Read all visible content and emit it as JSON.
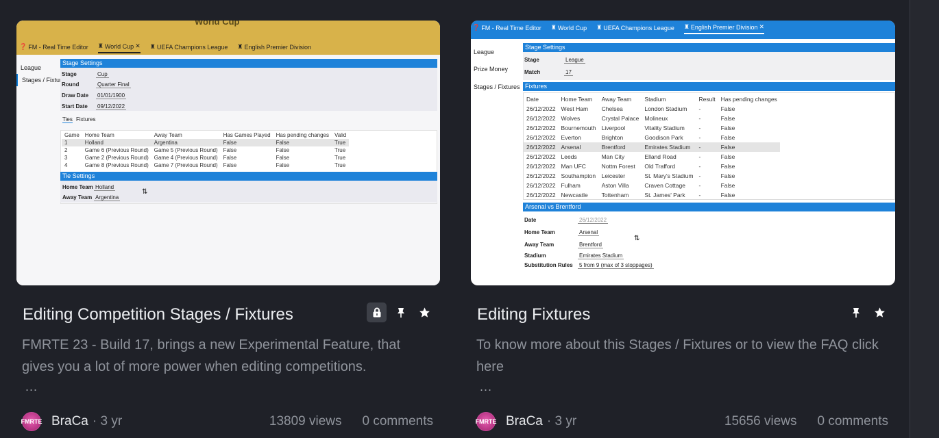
{
  "cards": [
    {
      "title": "Editing Competition Stages / Fixtures",
      "locked": true,
      "excerpt": "FMRTE 23 - Build 17, brings a new Experimental Feature, that gives you a lot of more power when editing competitions.",
      "ellipsis": "...",
      "author": "BraCa",
      "age": "3 yr",
      "views": "13809 views",
      "comments": "0 comments",
      "avatar_text": "FMRTE",
      "thumbnail": {
        "banner_text": "World Cup",
        "tabs": [
          "FM - Real Time Editor",
          "World Cup",
          "UEFA Champions League",
          "English Premier Division"
        ],
        "active_tab_index": 1,
        "sidebar": [
          "League",
          "Stages / Fixtures"
        ],
        "section_stage": "Stage Settings",
        "fields": [
          {
            "label": "Stage",
            "value": "Cup"
          },
          {
            "label": "Round",
            "value": "Quarter Final"
          },
          {
            "label": "Draw Date",
            "value": "01/01/1900"
          },
          {
            "label": "Start Date",
            "value": "09/12/2022"
          }
        ],
        "subtabs": [
          "Ties",
          "Fixtures"
        ],
        "table_headers": [
          "Game",
          "Home Team",
          "Away Team",
          "Has Games Played",
          "Has pending changes",
          "Valid"
        ],
        "rows": [
          [
            "1",
            "Holland",
            "Argentina",
            "False",
            "False",
            "True"
          ],
          [
            "2",
            "Game 6 (Previous Round)",
            "Game 5 (Previous Round)",
            "False",
            "False",
            "True"
          ],
          [
            "3",
            "Game 2 (Previous Round)",
            "Game 4 (Previous Round)",
            "False",
            "False",
            "True"
          ],
          [
            "4",
            "Game 8 (Previous Round)",
            "Game 7 (Previous Round)",
            "False",
            "False",
            "True"
          ]
        ],
        "section_tie": "Tie Settings",
        "tie_fields": [
          {
            "label": "Home Team",
            "value": "Holland"
          },
          {
            "label": "Away Team",
            "value": "Argentina"
          }
        ],
        "swap": "⇅"
      }
    },
    {
      "title": "Editing Fixtures",
      "locked": false,
      "excerpt": "To know more about this Stages / Fixtures or to view the FAQ click here",
      "ellipsis": "...",
      "author": "BraCa",
      "age": "3 yr",
      "views": "15656 views",
      "comments": "0 comments",
      "avatar_text": "FMRTE",
      "thumbnail": {
        "tabs": [
          "FM - Real Time Editor",
          "World Cup",
          "UEFA Champions League",
          "English Premier Division"
        ],
        "active_tab_index": 3,
        "sidebar": [
          "League",
          "Prize Money",
          "Stages / Fixtures"
        ],
        "section_stage": "Stage Settings",
        "fields": [
          {
            "label": "Stage",
            "value": "League"
          },
          {
            "label": "Match",
            "value": "17"
          }
        ],
        "section_fixtures": "Fixtures",
        "table_headers": [
          "Date",
          "Home Team",
          "Away Team",
          "Stadium",
          "Result",
          "Has pending changes"
        ],
        "rows": [
          [
            "26/12/2022",
            "West Ham",
            "Chelsea",
            "London Stadium",
            "-",
            "False"
          ],
          [
            "26/12/2022",
            "Wolves",
            "Crystal Palace",
            "Molineux",
            "-",
            "False"
          ],
          [
            "26/12/2022",
            "Bournemouth",
            "Liverpool",
            "Vitality Stadium",
            "-",
            "False"
          ],
          [
            "26/12/2022",
            "Everton",
            "Brighton",
            "Goodison Park",
            "-",
            "False"
          ],
          [
            "26/12/2022",
            "Arsenal",
            "Brentford",
            "Emirates Stadium",
            "-",
            "False"
          ],
          [
            "26/12/2022",
            "Leeds",
            "Man City",
            "Elland Road",
            "-",
            "False"
          ],
          [
            "26/12/2022",
            "Man UFC",
            "Nottm Forest",
            "Old Trafford",
            "-",
            "False"
          ],
          [
            "26/12/2022",
            "Southampton",
            "Leicester",
            "St. Mary's Stadium",
            "-",
            "False"
          ],
          [
            "26/12/2022",
            "Fulham",
            "Aston Villa",
            "Craven Cottage",
            "-",
            "False"
          ],
          [
            "26/12/2022",
            "Newcastle",
            "Tottenham",
            "St. James' Park",
            "-",
            "False"
          ]
        ],
        "section_match": "Arsenal vs Brentford",
        "match_fields": [
          {
            "label": "Date",
            "value": "26/12/2022"
          },
          {
            "label": "Home Team",
            "value": "Arsenal"
          },
          {
            "label": "Away Team",
            "value": "Brentford"
          },
          {
            "label": "Stadium",
            "value": "Emirates Stadium"
          },
          {
            "label": "Substitution Rules",
            "value": "5 from 9 (max of 3 stoppages)"
          }
        ],
        "swap": "⇅"
      }
    }
  ],
  "icons": {
    "lock": "lock-icon",
    "pin": "pin-icon",
    "star": "star-icon"
  },
  "colors": {
    "background": "#1f2128",
    "accent": "#1e82d9",
    "gold": "#d8b24a"
  }
}
